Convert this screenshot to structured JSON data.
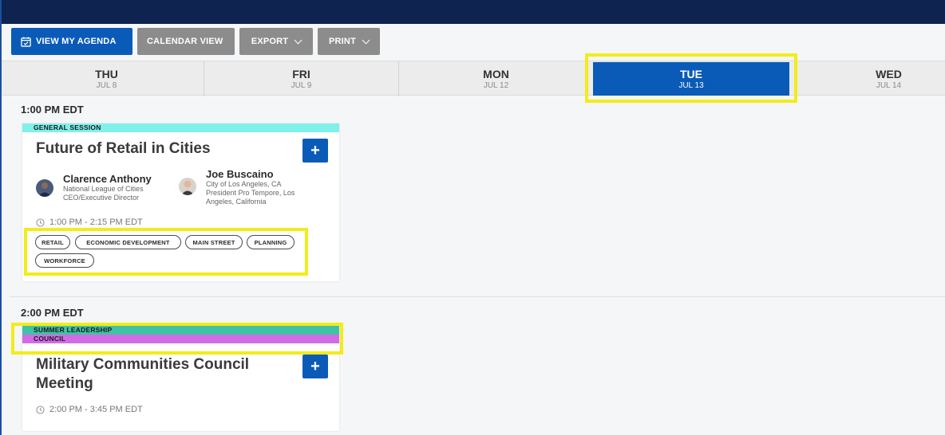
{
  "toolbar": {
    "agenda_label": "VIEW MY AGENDA",
    "calendar_label": "CALENDAR VIEW",
    "export_label": "EXPORT",
    "print_label": "PRINT"
  },
  "days": [
    {
      "name": "THU",
      "date": "JUL 8"
    },
    {
      "name": "FRI",
      "date": "JUL 9"
    },
    {
      "name": "MON",
      "date": "JUL 12"
    },
    {
      "name": "TUE",
      "date": "JUL 13",
      "selected": true
    },
    {
      "name": "WED",
      "date": "JUL 14"
    }
  ],
  "slots": [
    {
      "time": "1:00 PM EDT",
      "session": {
        "tracks": [
          {
            "label": "GENERAL SESSION",
            "color": "#7ff0ea"
          }
        ],
        "title": "Future of Retail in Cities",
        "add_label": "+",
        "speakers": [
          {
            "name": "Clarence Anthony",
            "role_lines": [
              "National League of Cities",
              "CEO/Executive Director"
            ]
          },
          {
            "name": "Joe Buscaino",
            "role_lines": [
              "City of Los Angeles, CA",
              "President Pro Tempore, Los",
              "Angeles, California"
            ]
          }
        ],
        "time_range": "1:00 PM - 2:15 PM EDT",
        "tags": [
          "RETAIL",
          "ECONOMIC DEVELOPMENT",
          "MAIN STREET",
          "PLANNING",
          "WORKFORCE"
        ]
      }
    },
    {
      "time": "2:00 PM EDT",
      "session": {
        "tracks": [
          {
            "label": "SUMMER LEADERSHIP",
            "color": "#3fc2a6"
          },
          {
            "label": "COUNCIL",
            "color": "#d36be6"
          }
        ],
        "title_lines": [
          "Military Communities Council",
          "Meeting"
        ],
        "add_label": "+",
        "time_range": "2:00 PM - 3:45 PM EDT"
      }
    }
  ],
  "colors": {
    "accent": "#0a5bb8",
    "header_bar": "#0f2350",
    "highlight": "#f2ec1a"
  }
}
